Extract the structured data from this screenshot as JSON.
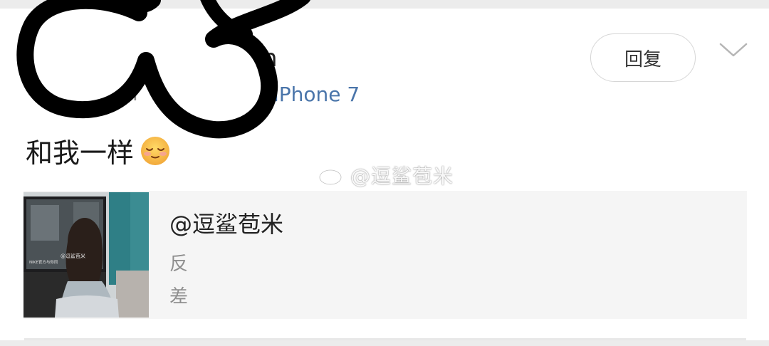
{
  "comment": {
    "username_visible": "n",
    "meta_partial": "Ⅰ",
    "device": "iPhone 7",
    "reply_label": "回复",
    "expand_icon": "chevron-down-icon",
    "text": "和我一样",
    "emoji": "blush-emoji"
  },
  "watermark": {
    "icon": "weibo-logo-icon",
    "text": "@逗鲨苞米"
  },
  "quote": {
    "author": "@逗鲨苞米",
    "lines": [
      "反",
      "差"
    ],
    "thumbnail": "quote-thumbnail-image",
    "thumbnail_watermark": "@逗鲨苞米",
    "thumbnail_caption": "NIKE官方与你同"
  },
  "colors": {
    "device_link": "#4a75aa",
    "quote_background": "#f5f5f5",
    "redaction": "#000000"
  }
}
